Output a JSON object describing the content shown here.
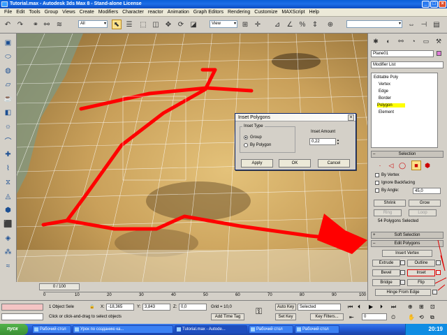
{
  "window": {
    "title": "Tutorial.max - Autodesk 3ds Max 8 - Stand-alone License"
  },
  "menu": [
    "File",
    "Edit",
    "Tools",
    "Group",
    "Views",
    "Create",
    "Modifiers",
    "Character",
    "reactor",
    "Animation",
    "Graph Editors",
    "Rendering",
    "Customize",
    "MAXScript",
    "Help"
  ],
  "toolbar": {
    "selection_filter": "All",
    "ref_coord": "View"
  },
  "dialog": {
    "title": "Inset Polygons",
    "inset_type_label": "Inset Type",
    "option_group": "Group",
    "option_by_polygon": "By Polygon",
    "inset_amount_label": "Inset Amount",
    "inset_amount_value": "0,22",
    "apply": "Apply",
    "ok": "OK",
    "cancel": "Cancel"
  },
  "command_panel": {
    "object_name": "Plane01",
    "modifier_list": "Modifier List",
    "stack": {
      "root": "Editable Poly",
      "vertex": "Vertex",
      "edge": "Edge",
      "border": "Border",
      "polygon": "Polygon",
      "element": "Element"
    },
    "selection": {
      "header": "Selection",
      "by_vertex": "By Vertex",
      "ignore_backfacing": "Ignore Backfacing",
      "by_angle": "By Angle:",
      "angle_value": "45,0",
      "shrink": "Shrink",
      "grow": "Grow",
      "ring": "Ring",
      "loop": "Loop",
      "status": "54 Polygons Selected"
    },
    "soft_selection": "Soft Selection",
    "edit_polygons": {
      "header": "Edit Polygons",
      "insert_vertex": "Insert Vertex",
      "extrude": "Extrude",
      "outline": "Outline",
      "bevel": "Bevel",
      "inset": "Inset",
      "bridge": "Bridge",
      "flip": "Flip",
      "hinge": "Hinge From Edge"
    }
  },
  "timeline": {
    "slider": "0 / 100",
    "ticks": [
      "0",
      "10",
      "20",
      "30",
      "40",
      "50",
      "60",
      "70",
      "80",
      "90",
      "100"
    ]
  },
  "status": {
    "selected": "1 Object Sele",
    "x_label": "X:",
    "x": "-18,365",
    "y_label": "Y:",
    "y": "3,843",
    "z_label": "Z:",
    "z": "0,0",
    "grid": "Grid = 10,0",
    "prompt": "Click or click-and-drag to select objects",
    "add_time_tag": "Add Time Tag",
    "auto_key": "Auto Key",
    "set_key": "Set Key",
    "selected_dropdown": "Selected",
    "key_filters": "Key Filters...",
    "frame": "0"
  },
  "taskbar": {
    "start": "пуск",
    "tasks": [
      "Рабочий стол",
      "Урок по созданию ка...",
      "Tutorial.max - Autode...",
      "Рабочий стол",
      "Рабочий стол"
    ],
    "clock": "20:19"
  },
  "colors": {
    "selected_polygon": "#ff0000",
    "highlight": "#ffff00",
    "titlebar": "#0a5fd8"
  }
}
